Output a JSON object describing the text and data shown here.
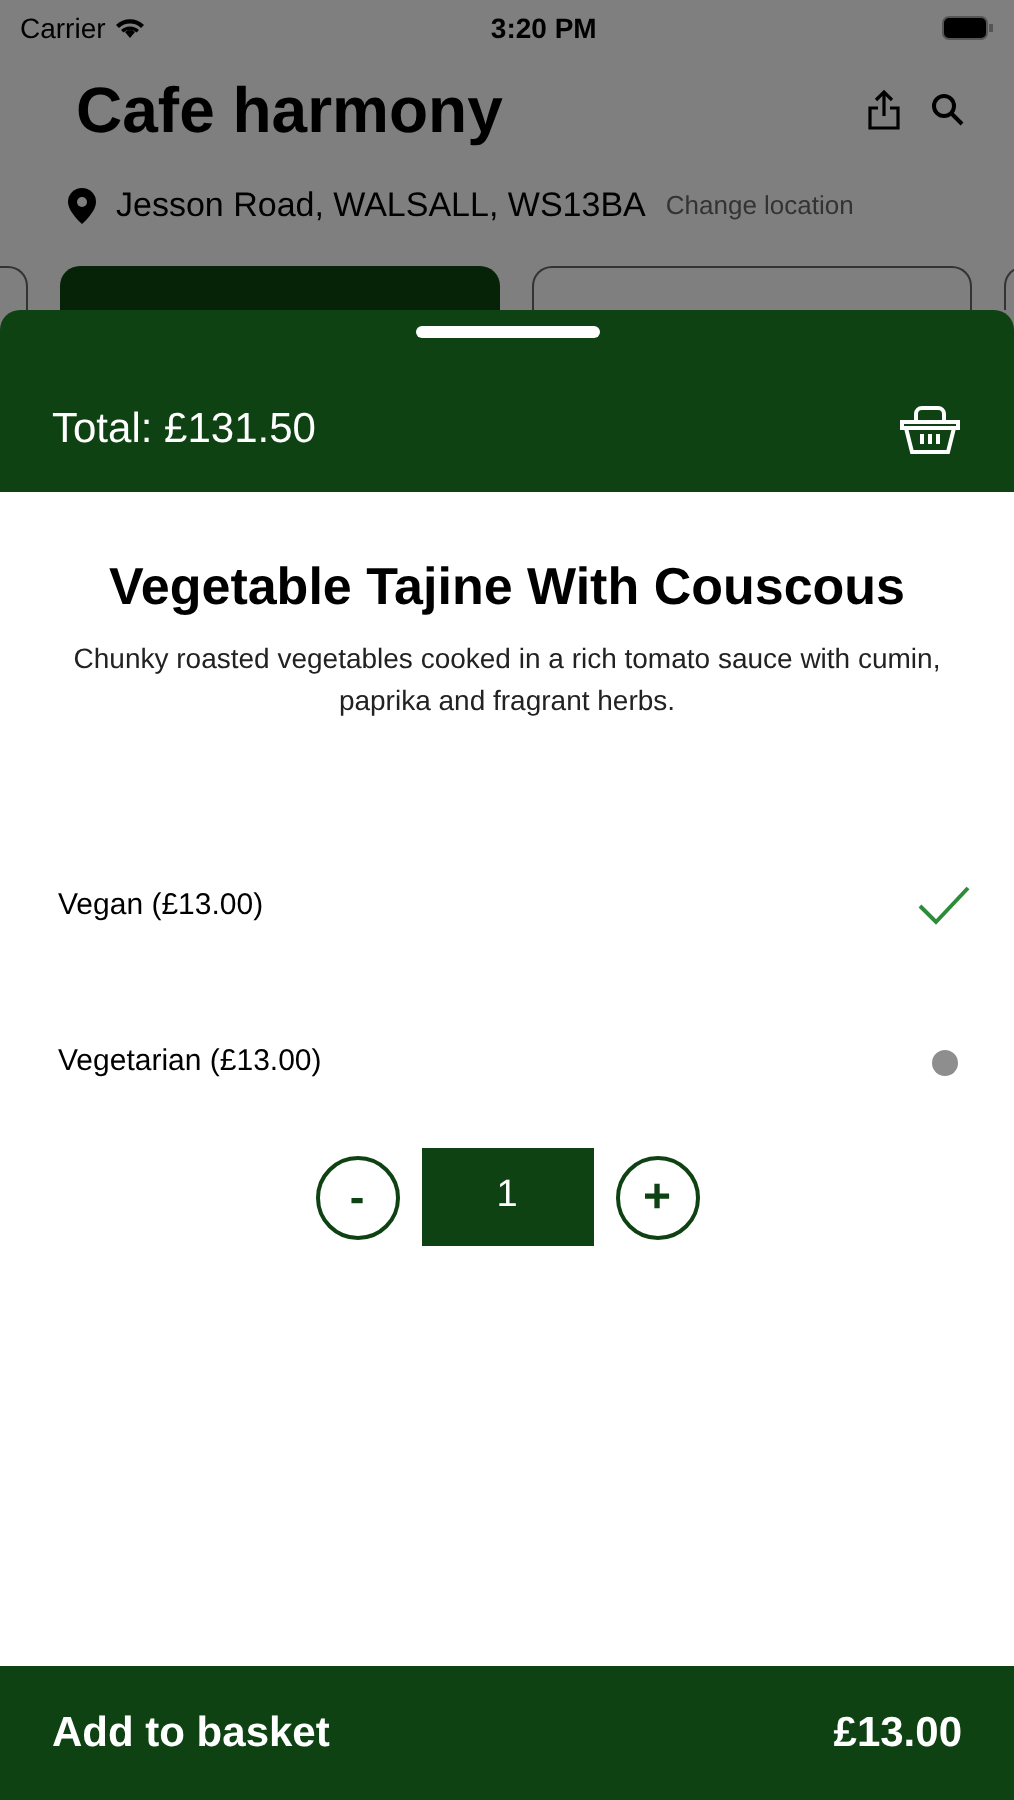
{
  "status_bar": {
    "carrier": "Carrier",
    "time": "3:20 PM"
  },
  "header": {
    "title": "Cafe harmony",
    "location": "Jesson Road, WALSALL, WS13BA",
    "change_location": "Change location"
  },
  "category_tabs": [
    {
      "selected": false
    },
    {
      "selected": true
    },
    {
      "selected": false
    },
    {
      "selected": false
    }
  ],
  "sheet": {
    "total": "Total: £131.50"
  },
  "item": {
    "name": "Vegetable Tajine With Couscous",
    "description": "Chunky roasted vegetables cooked in a rich tomato sauce with cumin, paprika and fragrant herbs."
  },
  "options": [
    {
      "label": "Vegan (£13.00)",
      "selected": true
    },
    {
      "label": "Vegetarian (£13.00)",
      "selected": false
    }
  ],
  "quantity": {
    "minus": "-",
    "value": "1",
    "plus": "+"
  },
  "add_bar": {
    "label": "Add to basket",
    "price": "£13.00"
  }
}
